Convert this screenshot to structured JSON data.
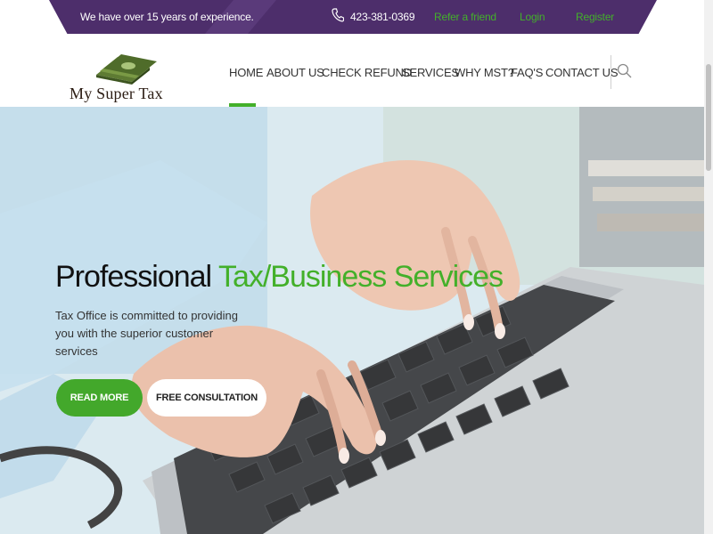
{
  "topbar": {
    "experience": "We have over 15 years of experience.",
    "phone": "423-381-0369",
    "links": [
      "Refer a friend",
      "Login",
      "Register"
    ]
  },
  "logo": {
    "text": "My Super Tax",
    "icon": "money-stack-icon"
  },
  "nav": {
    "items": [
      "HOME",
      "ABOUT US",
      "CHECK REFUND",
      "SERVICES",
      "WHY MST?",
      "FAQ'S",
      "CONTACT US"
    ],
    "active": "HOME"
  },
  "hero": {
    "title_plain": "Professional ",
    "title_accent": "Tax/Business Services",
    "description": "Tax Office is committed to providing you with the superior customer services",
    "read_more": "READ MORE",
    "free_consultation": "FREE CONSULTATION"
  },
  "colors": {
    "topbar": "#4d2e6b",
    "accent": "#43b02a",
    "text": "#333333"
  }
}
